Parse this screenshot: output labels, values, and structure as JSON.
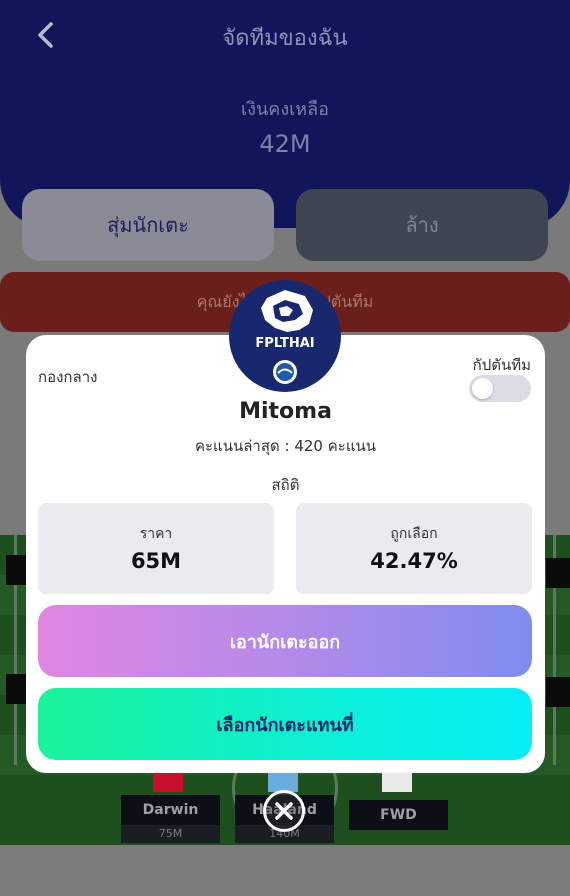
{
  "header": {
    "title": "จัดทีมของฉัน",
    "budget_label": "เงินคงเหลือ",
    "budget_value": "42M"
  },
  "actions": {
    "random_label": "สุ่มนักเตะ",
    "clear_label": "ล้าง"
  },
  "banner": {
    "text": "คุณยังไม่ได้เลือกกัปตันทีม"
  },
  "badge": {
    "text": "FPLTHAI"
  },
  "modal": {
    "position": "กองกลาง",
    "captain_label": "กัปตันทีม",
    "captain_on": false,
    "player_name": "Mitoma",
    "points": "คะแนนล่าสุด : 420 คะแนน",
    "stats_label": "สถิติ",
    "price_label": "ราคา",
    "price_value": "65M",
    "picked_label": "ถูกเลือก",
    "picked_value": "42.47%",
    "remove_label": "เอานักเตะออก",
    "replace_label": "เลือกนักเตะแทนที่"
  },
  "forwards": [
    {
      "name": "Darwin",
      "price": "75M"
    },
    {
      "name": "Haaland",
      "price": "140M"
    },
    {
      "name": "FWD",
      "price": ""
    }
  ],
  "colors": {
    "header_bg": "#11165a",
    "remove_gradient": [
      "#e085e3",
      "#7f8ced"
    ],
    "replace_gradient": [
      "#19f39a",
      "#06eef7"
    ]
  }
}
